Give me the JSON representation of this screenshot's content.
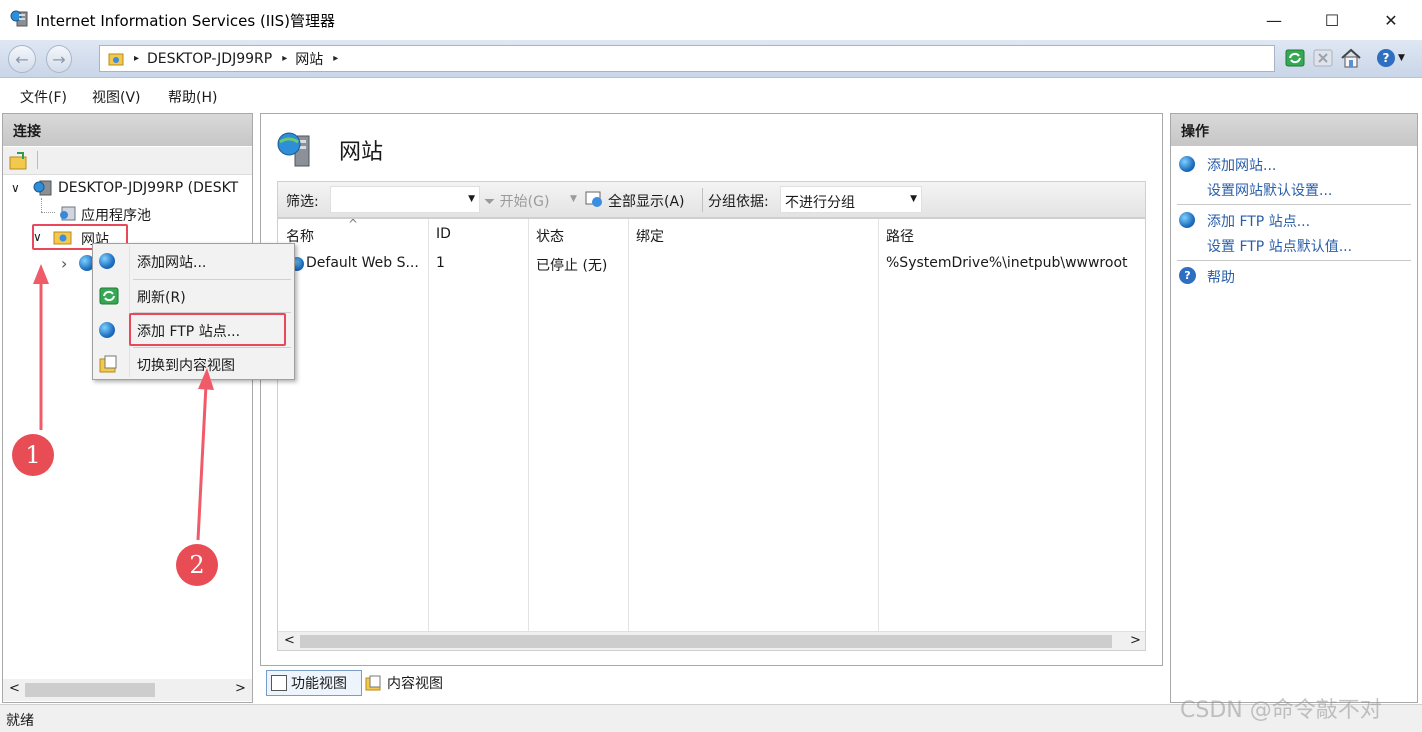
{
  "window": {
    "title": "Internet Information Services (IIS)管理器",
    "minimize": "—",
    "maximize": "☐",
    "close": "✕"
  },
  "address": {
    "back": "←",
    "forward": "→",
    "segments": [
      "DESKTOP-JDJ99RP",
      "网站"
    ],
    "arrow": "▸",
    "help": "?"
  },
  "menu": {
    "file": "文件(F)",
    "view": "视图(V)",
    "help": "帮助(H)"
  },
  "connections": {
    "header": "连接",
    "tree": {
      "server": "DESKTOP-JDJ99RP (DESKT",
      "app_pools": "应用程序池",
      "sites": "网站",
      "collapse_glyph": "∨",
      "expand_glyph": "›"
    },
    "scroll_left": "<",
    "scroll_right": ">"
  },
  "center": {
    "title": "网站",
    "filter": {
      "label": "筛选:",
      "start": "开始(G)",
      "show_all": "全部显示(A)",
      "group_label": "分组依据:",
      "group_value": "不进行分组"
    },
    "columns": [
      "名称",
      "ID",
      "状态",
      "绑定",
      "路径"
    ],
    "sort_glyph": "^",
    "rows": [
      {
        "name": "Default Web S...",
        "id": "1",
        "status": "已停止 (无)",
        "binding": "",
        "path": "%SystemDrive%\\inetpub\\wwwroot"
      }
    ],
    "scroll_left": "<",
    "scroll_right": ">",
    "tabs": {
      "features": "功能视图",
      "content": "内容视图"
    }
  },
  "actions": {
    "header": "操作",
    "add_site": "添加网站...",
    "site_defaults": "设置网站默认设置...",
    "add_ftp": "添加 FTP 站点...",
    "ftp_defaults": "设置 FTP 站点默认值...",
    "help": "帮助"
  },
  "context_menu": {
    "add_site": "添加网站...",
    "refresh": "刷新(R)",
    "add_ftp": "添加 FTP 站点...",
    "switch_content": "切换到内容视图"
  },
  "annotations": {
    "badge1": "1",
    "badge2": "2"
  },
  "status": {
    "text": "就绪"
  },
  "watermark": "CSDN @命令敲不对",
  "colors": {
    "accent_red": "#e8485a",
    "link_blue": "#2a5ea9"
  }
}
